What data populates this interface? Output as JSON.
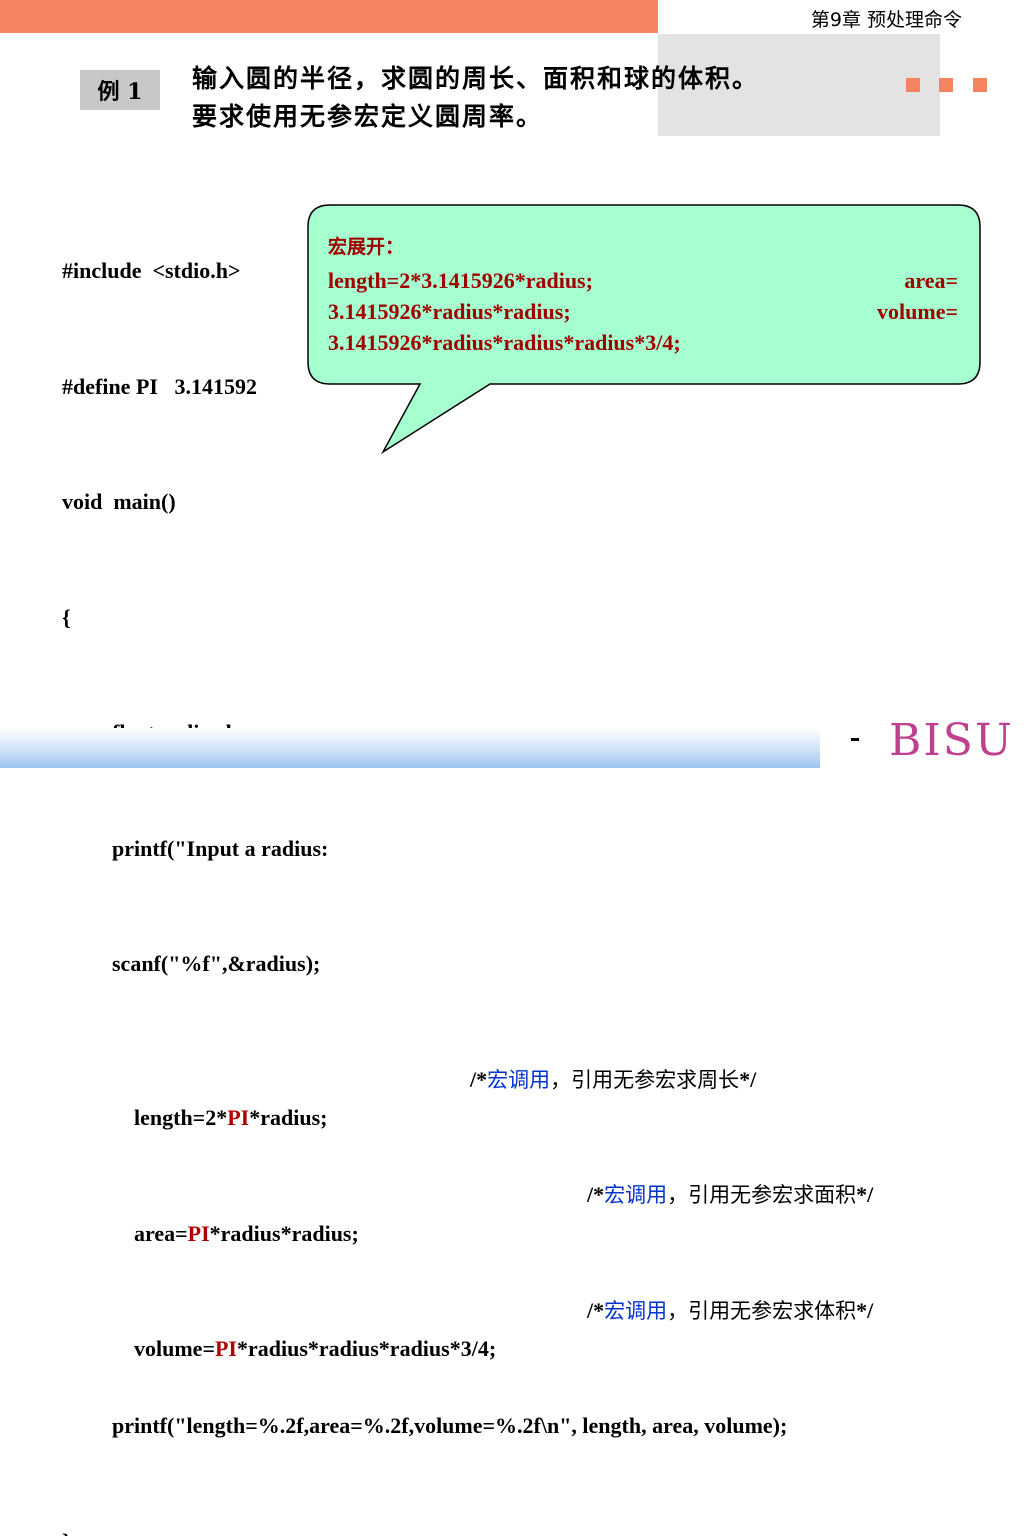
{
  "header": {
    "chapter": "第9章  预处理命令"
  },
  "example": {
    "badge": "例 1",
    "problem_line1": "输入圆的半径，求圆的周长、面积和球的体积。",
    "problem_line2": "要求使用无参宏定义圆周率。"
  },
  "code": {
    "l1": "#include  <stdio.h>",
    "l2": "#define PI   3.141592",
    "l3": "void  main()",
    "l4": "{",
    "l5": "float radius,leng",
    "l6": "printf(\"Input a radius:",
    "l7": "scanf(\"%f\",&radius);",
    "l8a": "length=2*",
    "l8pi": "PI",
    "l8b": "*radius;",
    "l9a": "area=",
    "l9pi": "PI",
    "l9b": "*radius*radius;",
    "l10a": "volume=",
    "l10pi": "PI",
    "l10b": "*radius*radius*radius*3/4;",
    "l11": "printf(\"length=%.2f,area=%.2f,volume=%.2f\\n\", length, area, volume);",
    "l12": "}",
    "comment_open": "/*",
    "comment_close": "*/",
    "macro_call": "宏调用",
    "c8": "，引用无参宏求周长",
    "c9": "，引用无参宏求面积",
    "c10": "，引用无参宏求体积"
  },
  "callout": {
    "title": "宏展开：",
    "r1a": "length=2*3.1415926*radius;",
    "r1b": "area=",
    "r2a": "3.1415926*radius*radius;",
    "r2b": "volume=",
    "r3": "3.1415926*radius*radius*radius*3/4;"
  },
  "footer": {
    "logo": "BISU"
  },
  "colors": {
    "accent": "#f4845f",
    "callout_fill": "#a6ffcf",
    "macro_red": "#b00000",
    "comment_blue": "#0033cc"
  }
}
